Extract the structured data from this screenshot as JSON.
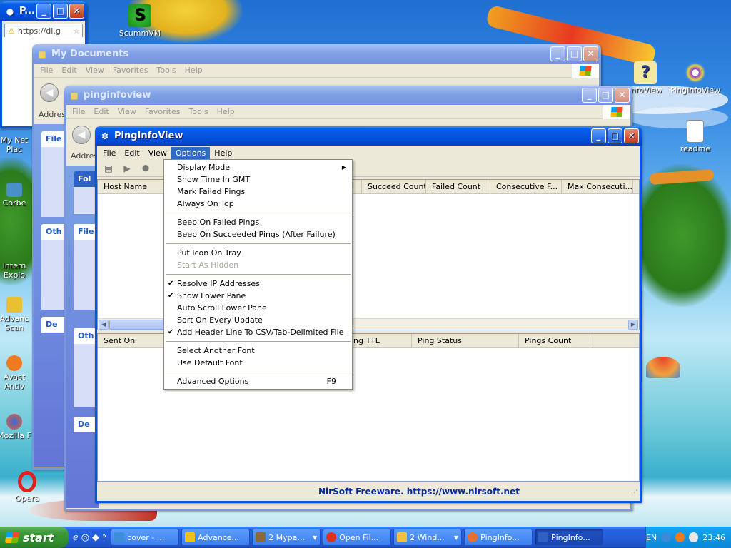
{
  "desktop": {
    "icons": [
      {
        "label": "ScummVM",
        "name": "scummvm-icon"
      },
      {
        "label": "InfoView",
        "name": "infoview-icon"
      },
      {
        "label": "PingInfoView",
        "name": "pinginfoview-icon"
      },
      {
        "label": "readme",
        "name": "readme-icon"
      },
      {
        "label": "My Net Plac",
        "name": "my-network-places-icon"
      },
      {
        "label": "Corbe",
        "name": "corbe-icon"
      },
      {
        "label": "Intern Explo",
        "name": "internet-explorer-icon"
      },
      {
        "label": "Advanc Scan",
        "name": "advanced-scan-icon"
      },
      {
        "label": "Avast Antiv",
        "name": "avast-icon"
      },
      {
        "label": "Mozilla F",
        "name": "mozilla-icon"
      },
      {
        "label": "Opera",
        "name": "opera-icon"
      }
    ]
  },
  "browser_window": {
    "title": "P...",
    "address": "https://dl.g"
  },
  "my_documents": {
    "title": "My Documents",
    "menu": [
      "File",
      "Edit",
      "View",
      "Favorites",
      "Tools",
      "Help"
    ],
    "address_label": "Address",
    "side_headers": [
      "File",
      "Oth",
      "De"
    ]
  },
  "pinginfoview_folder": {
    "title": "pinginfoview",
    "menu": [
      "File",
      "Edit",
      "View",
      "Favorites",
      "Tools",
      "Help"
    ],
    "address_label": "Addres",
    "side_headers": [
      "Fol",
      "File",
      "Oth",
      "De"
    ]
  },
  "pinginfoview": {
    "title": "PingInfoView",
    "menu": [
      "File",
      "Edit",
      "View",
      "Options",
      "Help"
    ],
    "top_columns": [
      "Host Name",
      "Succeed Count",
      "Failed Count",
      "Consecutive F...",
      "Max Consecuti..."
    ],
    "bottom_columns": [
      "Sent On",
      "ng TTL",
      "Ping Status",
      "Pings Count"
    ],
    "status_link": "NirSoft Freeware. https://www.nirsoft.net"
  },
  "options_menu": {
    "groups": [
      [
        {
          "label": "Display Mode",
          "submenu": true
        },
        {
          "label": "Show Time In GMT"
        },
        {
          "label": "Mark Failed Pings"
        },
        {
          "label": "Always On Top"
        }
      ],
      [
        {
          "label": "Beep On Failed Pings"
        },
        {
          "label": "Beep On Succeeded Pings (After Failure)"
        }
      ],
      [
        {
          "label": "Put Icon On Tray"
        },
        {
          "label": "Start As Hidden",
          "disabled": true
        }
      ],
      [
        {
          "label": "Resolve IP Addresses",
          "checked": true
        },
        {
          "label": "Show Lower Pane",
          "checked": true
        },
        {
          "label": "Auto Scroll Lower Pane"
        },
        {
          "label": "Sort On Every Update"
        },
        {
          "label": "Add Header Line To CSV/Tab-Delimited File",
          "checked": true
        }
      ],
      [
        {
          "label": "Select Another Font"
        },
        {
          "label": "Use Default Font"
        }
      ],
      [
        {
          "label": "Advanced Options",
          "shortcut": "F9"
        }
      ]
    ]
  },
  "taskbar": {
    "start_label": "start",
    "tasks": [
      {
        "label": "cover - ...",
        "color": "#3a8fd8"
      },
      {
        "label": "Advance...",
        "color": "#f0c020"
      },
      {
        "label": "2 Mypa...",
        "color": "#8a6a3a"
      },
      {
        "label": "Open Fil...",
        "color": "#e0301e"
      },
      {
        "label": "2 Wind...",
        "color": "#f0c040"
      },
      {
        "label": "PingInfo...",
        "color": "#e8702a"
      },
      {
        "label": "PingInfo...",
        "color": "#3060c0",
        "active": true
      }
    ],
    "language": "EN",
    "clock": "23:46"
  },
  "colors": {
    "xp_blue": "#0a55e0",
    "selection": "#316ac5",
    "start_green": "#3c9a36"
  }
}
